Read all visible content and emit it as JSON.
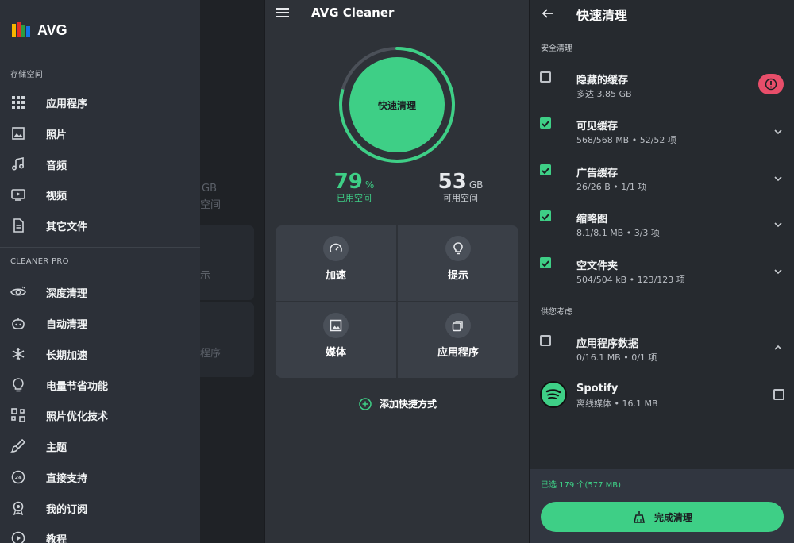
{
  "drawer": {
    "brand": "AVG",
    "storage_label": "存储空间",
    "storage_items": [
      {
        "label": "应用程序",
        "icon": "apps-grid-icon"
      },
      {
        "label": "照片",
        "icon": "image-icon"
      },
      {
        "label": "音频",
        "icon": "music-note-icon"
      },
      {
        "label": "视频",
        "icon": "video-icon"
      },
      {
        "label": "其它文件",
        "icon": "document-icon"
      }
    ],
    "pro_label": "CLEANER PRO",
    "pro_items": [
      {
        "label": "深度清理",
        "icon": "eye-icon"
      },
      {
        "label": "自动清理",
        "icon": "robot-icon"
      },
      {
        "label": "长期加速",
        "icon": "snowflake-icon"
      },
      {
        "label": "电量节省功能",
        "icon": "lightbulb-icon"
      },
      {
        "label": "照片优化技术",
        "icon": "photo-optimize-icon"
      },
      {
        "label": "主题",
        "icon": "brush-icon"
      },
      {
        "label": "直接支持",
        "icon": "support-24-icon"
      },
      {
        "label": "我的订阅",
        "icon": "badge-icon"
      },
      {
        "label": "教程",
        "icon": "play-circle-icon"
      }
    ],
    "behind": {
      "gb": "GB",
      "space": "空间",
      "hint": "示",
      "apps": "程序"
    }
  },
  "main": {
    "title": "AVG Cleaner",
    "quick_clean": "快速清理",
    "used_value": "79",
    "used_unit": "%",
    "used_caption": "已用空间",
    "free_value": "53",
    "free_unit": "GB",
    "free_caption": "可用空间",
    "used_fraction": 0.79,
    "tiles": [
      {
        "label": "加速",
        "icon": "speedometer-icon"
      },
      {
        "label": "提示",
        "icon": "lightbulb-icon"
      },
      {
        "label": "媒体",
        "icon": "image-icon"
      },
      {
        "label": "应用程序",
        "icon": "apps-stack-icon"
      }
    ],
    "add_shortcut": "添加快捷方式"
  },
  "quick": {
    "title": "快速清理",
    "safe_label": "安全清理",
    "safe_items": [
      {
        "title": "隐藏的缓存",
        "sub": "多达 3.85 GB",
        "checked": false
      },
      {
        "title": "可见缓存",
        "sub": "568/568 MB • 52/52 项",
        "checked": true
      },
      {
        "title": "广告缓存",
        "sub": "26/26 B • 1/1 项",
        "checked": true
      },
      {
        "title": "缩略图",
        "sub": "8.1/8.1 MB • 3/3 项",
        "checked": true
      },
      {
        "title": "空文件夹",
        "sub": "504/504 kB • 123/123 项",
        "checked": true
      }
    ],
    "consider_label": "供您考虑",
    "app_data": {
      "title": "应用程序数据",
      "sub": "0/16.1 MB • 0/1 项",
      "checked": false
    },
    "spotify": {
      "title": "Spotify",
      "sub": "离线媒体 • 16.1 MB",
      "checked": false
    },
    "selected_info": "已选 179 个(577 MB)",
    "done_label": "完成清理",
    "accent": "#3ecf86",
    "warn_color": "#e84e6a"
  }
}
